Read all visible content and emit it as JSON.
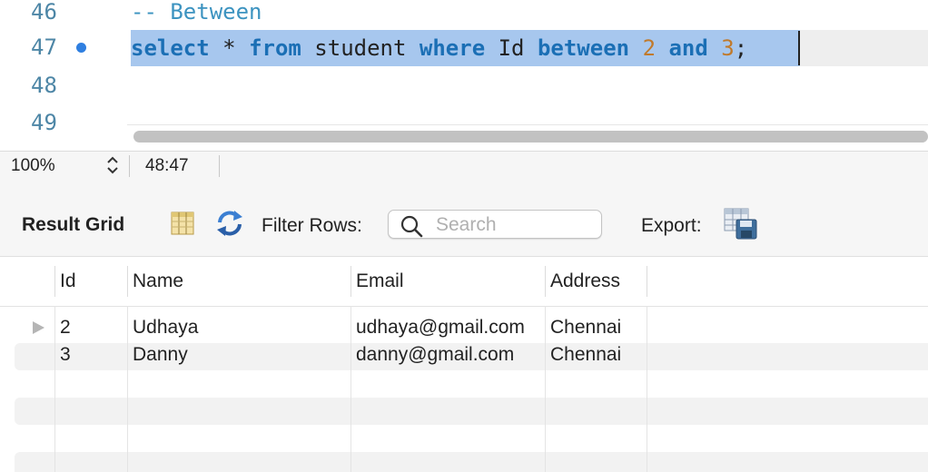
{
  "editor": {
    "lines": [
      {
        "num": "46",
        "tokens": [
          {
            "t": "-- Between",
            "c": "cmt"
          }
        ]
      },
      {
        "num": "47",
        "tokens": [
          {
            "t": "select",
            "c": "kw"
          },
          {
            "t": " ",
            "c": "plain"
          },
          {
            "t": "*",
            "c": "plain"
          },
          {
            "t": " ",
            "c": "plain"
          },
          {
            "t": "from",
            "c": "kw"
          },
          {
            "t": " student ",
            "c": "plain"
          },
          {
            "t": "where",
            "c": "kw"
          },
          {
            "t": " Id ",
            "c": "plain"
          },
          {
            "t": "between",
            "c": "kw"
          },
          {
            "t": " ",
            "c": "plain"
          },
          {
            "t": "2",
            "c": "num"
          },
          {
            "t": " ",
            "c": "plain"
          },
          {
            "t": "and",
            "c": "kw"
          },
          {
            "t": " ",
            "c": "plain"
          },
          {
            "t": "3",
            "c": "num"
          },
          {
            "t": ";",
            "c": "plain"
          }
        ]
      },
      {
        "num": "48",
        "tokens": []
      },
      {
        "num": "49",
        "tokens": []
      }
    ]
  },
  "status": {
    "zoom": "100%",
    "position": "48:47"
  },
  "toolbar": {
    "result_grid_label": "Result Grid",
    "filter_label": "Filter Rows:",
    "search_placeholder": "Search",
    "export_label": "Export:",
    "icons": {
      "grid": "grid-columns-icon",
      "refresh": "refresh-icon",
      "search": "search-icon",
      "export": "export-table-icon"
    }
  },
  "grid": {
    "columns": [
      "Id",
      "Name",
      "Email",
      "Address"
    ],
    "rows": [
      [
        "2",
        "Udhaya",
        "udhaya@gmail.com",
        "Chennai"
      ],
      [
        "3",
        "Danny",
        "danny@gmail.com",
        "Chennai"
      ]
    ]
  },
  "colors": {
    "selection": "#a7c7ee",
    "keyword": "#1b6fb5",
    "comment": "#3c93c0",
    "number": "#c07a2c",
    "line_number": "#4d86a6",
    "breakpoint": "#2f7fe0"
  }
}
